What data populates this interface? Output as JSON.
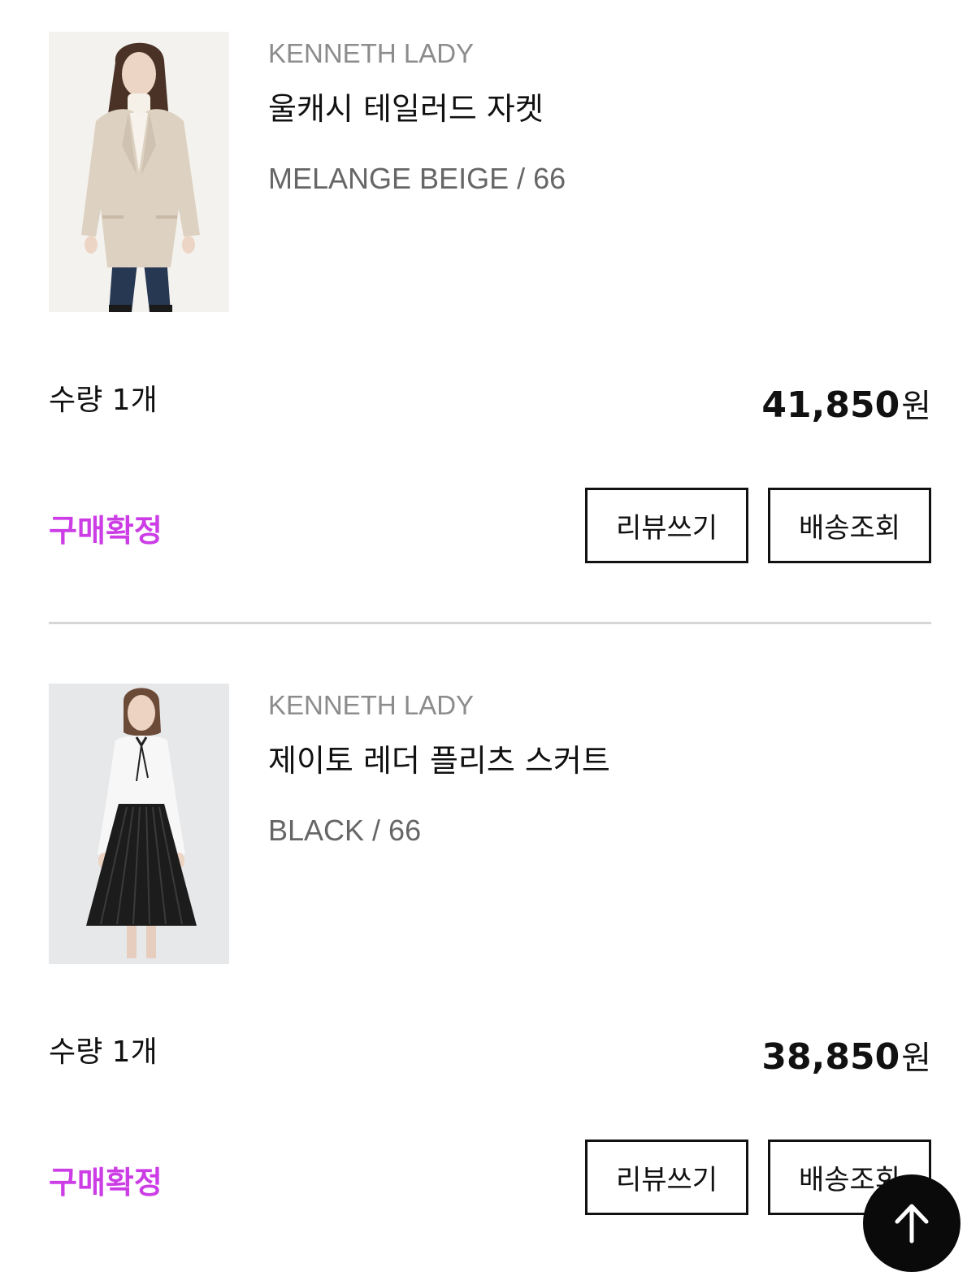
{
  "orders": [
    {
      "brand": "KENNETH LADY",
      "product_name": "울캐시 테일러드 자켓",
      "option": "MELANGE BEIGE / 66",
      "quantity": "수량 1개",
      "price": "41,850",
      "currency": "원",
      "status": "구매확정",
      "review_button": "리뷰쓰기",
      "track_button": "배송조회",
      "image_icon": "product-photo-woman-beige-blazer"
    },
    {
      "brand": "KENNETH LADY",
      "product_name": "제이토 레더 플리츠 스커트",
      "option": "BLACK / 66",
      "quantity": "수량 1개",
      "price": "38,850",
      "currency": "원",
      "status": "구매확정",
      "review_button": "리뷰쓰기",
      "track_button": "배송조회",
      "image_icon": "product-photo-woman-black-pleated-skirt"
    }
  ],
  "colors": {
    "status": "#cc3de6",
    "divider": "#d6d6d6",
    "text_primary": "#111111",
    "text_muted": "#8c8c8c",
    "scroll_top_bg": "#0a0a0a"
  },
  "scroll_top_icon": "arrow-up-icon"
}
